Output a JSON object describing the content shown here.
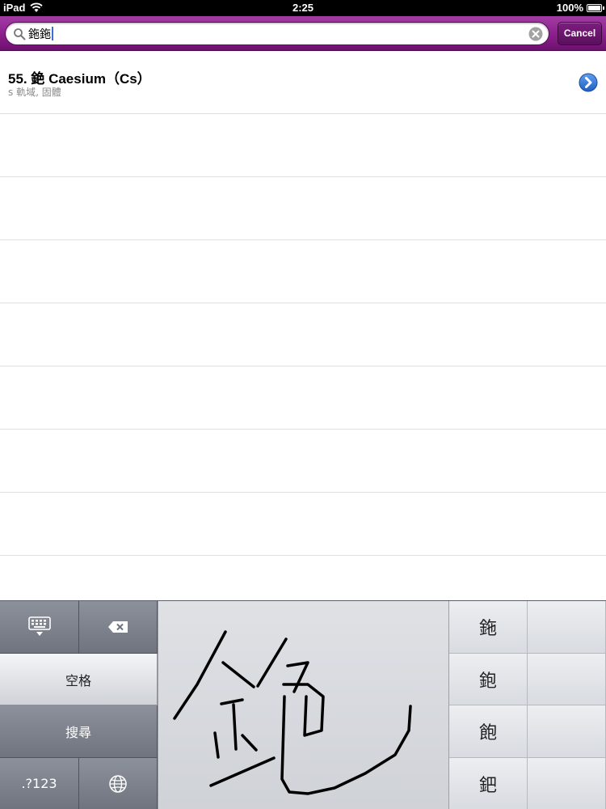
{
  "status_bar": {
    "carrier": "iPad",
    "time": "2:25",
    "battery": "100%"
  },
  "search": {
    "query": "鉇鉇",
    "cancel_label": "Cancel"
  },
  "results": [
    {
      "title": "55. 銫 Caesium（Cs）",
      "subtitle": "s 軌域, 固體"
    }
  ],
  "keyboard": {
    "space_label": "空格",
    "search_label": "搜尋",
    "numbers_label": ".?123",
    "candidates": [
      "鉇",
      "鉋",
      "飽",
      "鈀"
    ]
  },
  "colors": {
    "accent": "#8a1f8c",
    "caret": "#3b6fd8"
  }
}
